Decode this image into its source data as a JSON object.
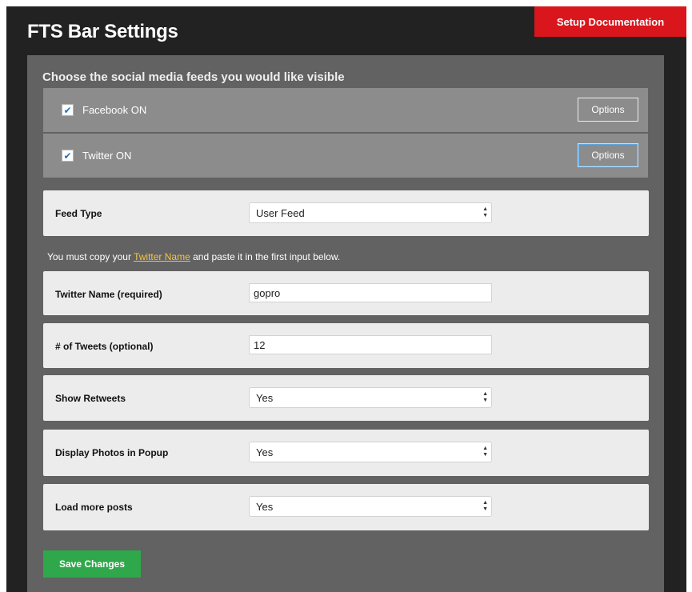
{
  "header": {
    "title": "FTS Bar Settings",
    "doc_button": "Setup Documentation"
  },
  "panel": {
    "heading": "Choose the social media feeds you would like visible",
    "feeds": [
      {
        "label": "Facebook ON",
        "checked": true,
        "options_label": "Options"
      },
      {
        "label": "Twitter ON",
        "checked": true,
        "options_label": "Options"
      }
    ],
    "check_glyph": "✔"
  },
  "settings": {
    "feed_type": {
      "label": "Feed Type",
      "value": "User Feed"
    },
    "note": {
      "before": "You must copy your ",
      "link": "Twitter Name",
      "after": " and paste it in the first input below."
    },
    "twitter_name": {
      "label": "Twitter Name (required)",
      "value": "gopro"
    },
    "tweets": {
      "label": "# of Tweets (optional)",
      "value": "12"
    },
    "show_retweets": {
      "label": "Show Retweets",
      "value": "Yes"
    },
    "photos_popup": {
      "label": "Display Photos in Popup",
      "value": "Yes"
    },
    "load_more": {
      "label": "Load more posts",
      "value": "Yes"
    }
  },
  "save_button": "Save Changes",
  "colors": {
    "accent_red": "#d9161c",
    "save_green": "#2fa84b",
    "link_yellow": "#f7c244"
  }
}
